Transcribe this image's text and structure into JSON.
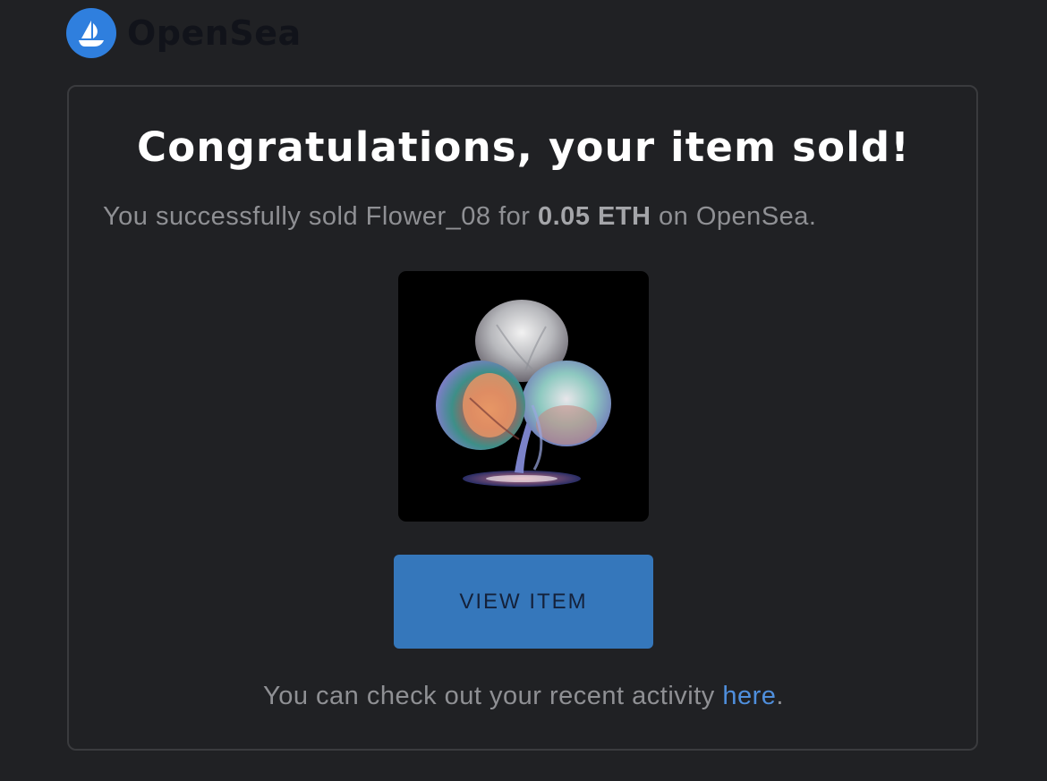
{
  "header": {
    "brand_name": "OpenSea",
    "logo_icon": "boat-logo-icon",
    "brand_color": "#2f7fde"
  },
  "email": {
    "headline": "Congratulations, your item sold!",
    "sold_prefix": "You successfully sold Flower_08 for ",
    "price": "0.05 ETH",
    "sold_suffix": " on OpenSea.",
    "image_alt_icon": "abstract-flower-image",
    "view_button_label": "VIEW ITEM",
    "button_color": "#3577bb",
    "activity_prefix": "You can check out your recent activity ",
    "activity_link": "here",
    "activity_suffix": ".",
    "link_color": "#4f8fdd"
  }
}
